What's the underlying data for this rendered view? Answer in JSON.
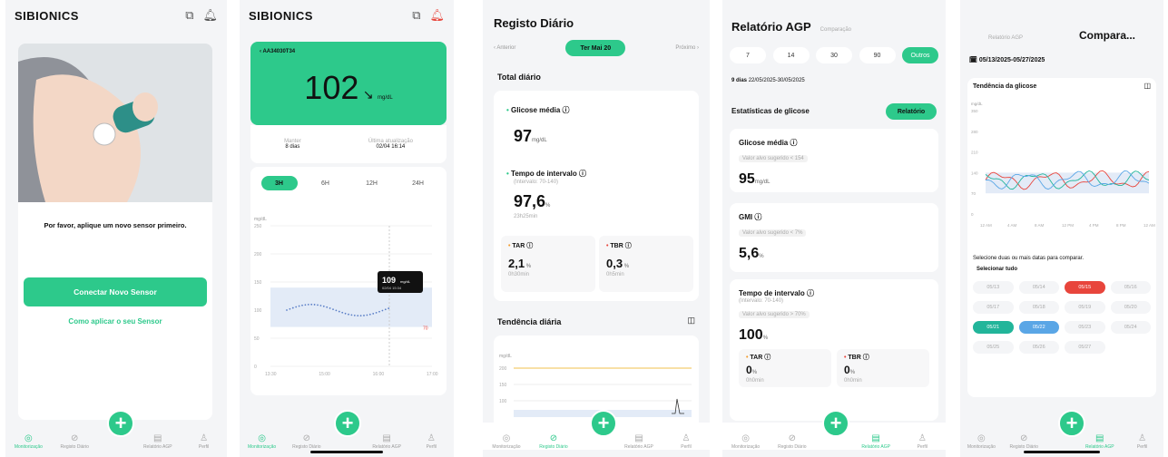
{
  "s1": {
    "brand": "SIBIONICS",
    "apply_text": "Por favor, aplique um novo sensor primeiro.",
    "connect_button": "Conectar Novo Sensor",
    "how_link": "Como aplicar o seu Sensor",
    "tabs": [
      "Monitorização",
      "Registo Diário",
      "Relatório AGP",
      "Perfil"
    ],
    "active_tab": 0
  },
  "s2": {
    "brand": "SIBIONICS",
    "sensor_id": "AA34030T34",
    "glucose": "102",
    "unit": "mg/dL",
    "arrow": "↘",
    "remain_label": "Manter",
    "remain_value": "8 dias",
    "update_label": "Última atualização",
    "update_value": "02/04 16:14",
    "ranges": [
      "3H",
      "6H",
      "12H",
      "24H"
    ],
    "active_range": 0,
    "y_unit": "mg/dL",
    "y_ticks": [
      "250",
      "200",
      "150",
      "100",
      "50",
      "0"
    ],
    "x_ticks": [
      "13:30",
      "15:00",
      "16:00",
      "17:00"
    ],
    "tooltip_value": "109",
    "tooltip_unit": "mg/dL",
    "tooltip_time": "02/04 15:34",
    "low_mark": "70",
    "tabs": [
      "Monitorização",
      "Registo Diário",
      "Relatório AGP",
      "Perfil"
    ],
    "active_tab": 0
  },
  "s3": {
    "title": "Registo Diário",
    "prev": "‹ Anterior",
    "date": "Ter Mai 20",
    "next": "Próximo ›",
    "total_title": "Total diário",
    "avg_label": "Glicose média ⓘ",
    "avg_value": "97",
    "avg_unit": "mg/dL",
    "tir_label": "Tempo de intervalo ⓘ",
    "tir_sub": "(Intervalo: 70-140)",
    "tir_value": "97,6",
    "tir_unit": "%",
    "tir_time": "23h25min",
    "tar_label": "TAR ⓘ",
    "tar_value": "2,1",
    "tar_time": "0h30min",
    "tbr_label": "TBR ⓘ",
    "tbr_value": "0,3",
    "tbr_time": "0h5min",
    "trend_title": "Tendência diária",
    "y_unit": "mg/dL",
    "y_ticks": [
      "200",
      "150",
      "100"
    ],
    "tabs": [
      "Monitorização",
      "Registo Diário",
      "Relatório AGP",
      "Perfil"
    ],
    "active_tab": 1
  },
  "s4": {
    "title": "Relatório AGP",
    "compare": "Comparação",
    "ranges": [
      "7",
      "14",
      "30",
      "90",
      "Outros"
    ],
    "active_range": 4,
    "days": "9 dias",
    "dates": "22/05/2025-30/05/2025",
    "stats_title": "Estatísticas de glicose",
    "report_btn": "Relatório",
    "avg_label": "Glicose média ⓘ",
    "avg_sub": "Valor alvo sugerido < 154",
    "avg_value": "95",
    "avg_unit": "mg/dL",
    "gmi_label": "GMI ⓘ",
    "gmi_sub": "Valor alvo sugerido < 7%",
    "gmi_value": "5,6",
    "gmi_unit": "%",
    "tir_label": "Tempo de intervalo ⓘ",
    "tir_range": "(Intervalo: 70-140)",
    "tir_sub": "Valor alvo sugerido > 70%",
    "tir_value": "100",
    "tir_unit": "%",
    "tar_label": "TAR ⓘ",
    "tar_value": "0",
    "tar_unit": "%",
    "tar_time": "0h0min",
    "tbr_label": "TBR ⓘ",
    "tbr_value": "0",
    "tbr_unit": "%",
    "tbr_time": "0h0min",
    "tabs": [
      "Monitorização",
      "Registo Diário",
      "Relatório AGP",
      "Perfil"
    ],
    "active_tab": 2
  },
  "s5": {
    "tab_report": "Relatório AGP",
    "tab_compare": "Compara...",
    "date_range": "05/13/2025-05/27/2025",
    "trend_title": "Tendência da glicose",
    "y_unit": "mg/dL",
    "y_ticks": [
      "350",
      "280",
      "210",
      "140",
      "70",
      "0"
    ],
    "x_ticks": [
      "12 AM",
      "4 AM",
      "8 AM",
      "12 PM",
      "4 PM",
      "8 PM",
      "12 AM"
    ],
    "select_text": "Selecione duas ou mais datas para comparar.",
    "select_all": "Selecionar tudo",
    "dates": [
      "05/13",
      "05/14",
      "05/15",
      "05/16",
      "05/17",
      "05/18",
      "05/19",
      "05/20",
      "05/21",
      "05/22",
      "05/23",
      "05/24",
      "05/25",
      "05/26",
      "05/27"
    ],
    "date_colors": {
      "05/15": "#e8453c",
      "05/21": "#22b59a",
      "05/22": "#5aa6e6"
    },
    "tabs": [
      "Monitorização",
      "Registo Diário",
      "Relatório AGP",
      "Perfil"
    ],
    "active_tab": 2
  },
  "colors": {
    "accent": "#2dc98b",
    "tar": "#f29b2b",
    "tbr": "#e8453c"
  }
}
